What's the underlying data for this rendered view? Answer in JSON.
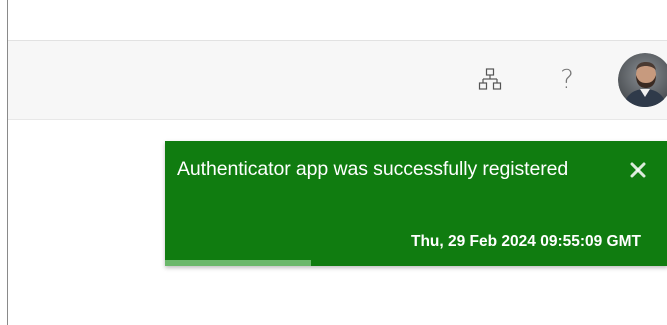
{
  "header": {
    "org_icon": "org-chart-icon",
    "help_label": "?",
    "avatar_icon": "user-avatar"
  },
  "toast": {
    "message": "Authenticator app was successfully registered",
    "timestamp": "Thu, 29 Feb 2024 09:55:09 GMT",
    "close_icon": "close-icon",
    "progress_fraction": 0.29,
    "background_color": "#107c10",
    "progress_color": "#6bb86b"
  }
}
